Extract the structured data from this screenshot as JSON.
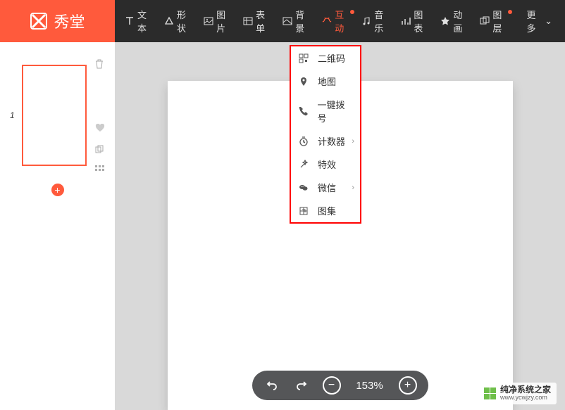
{
  "brand": "秀堂",
  "toolbar": {
    "text": "文本",
    "shape": "形状",
    "image": "图片",
    "form": "表单",
    "background": "背景",
    "interact": "互动",
    "music": "音乐",
    "chart": "图表",
    "animation": "动画",
    "layer": "图层",
    "more": "更多"
  },
  "sidebar": {
    "pageNumber": "1"
  },
  "dropdown": {
    "items": [
      {
        "label": "二维码",
        "hasSub": false
      },
      {
        "label": "地图",
        "hasSub": false
      },
      {
        "label": "一键拨号",
        "hasSub": false
      },
      {
        "label": "计数器",
        "hasSub": true
      },
      {
        "label": "特效",
        "hasSub": false
      },
      {
        "label": "微信",
        "hasSub": true
      },
      {
        "label": "图集",
        "hasSub": false
      }
    ]
  },
  "zoom": "153%",
  "watermark": {
    "title": "纯净系统之家",
    "url": "www.ycwjzy.com"
  }
}
